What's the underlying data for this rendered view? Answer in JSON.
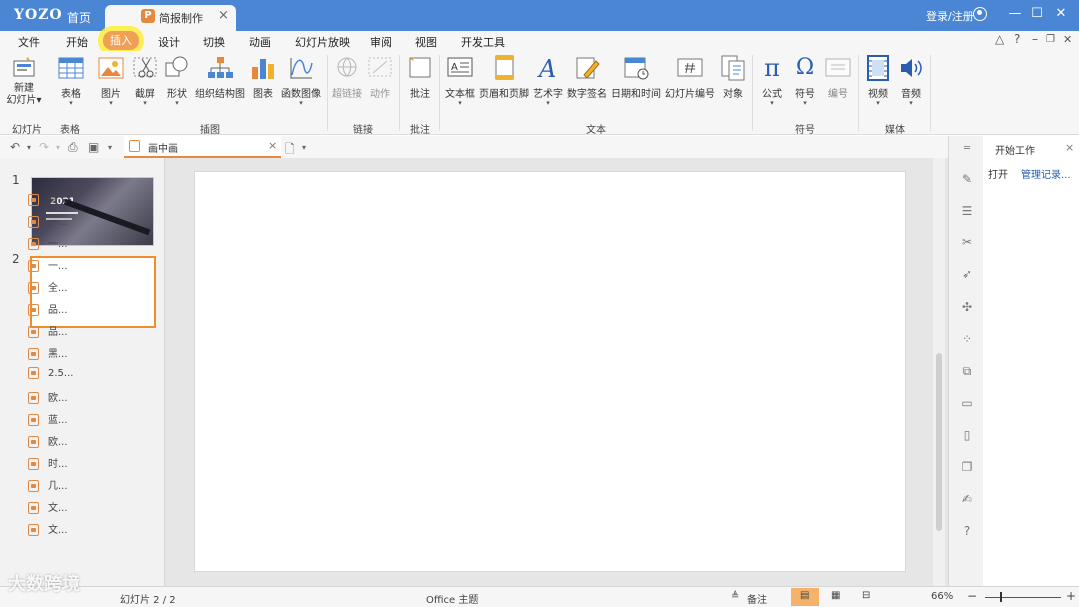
{
  "titlebar": {
    "logo": "YOZO",
    "home": "首页",
    "doc_tab": "简报制作",
    "tab_close": "×",
    "login": "登录/注册",
    "win_min": "—",
    "win_max": "☐",
    "win_close": "✕"
  },
  "menu": {
    "file": "文件",
    "home": "开始",
    "insert": "插入",
    "design": "设计",
    "transition": "切换",
    "animation": "动画",
    "slideshow": "幻灯片放映",
    "review": "审阅",
    "view": "视图",
    "devtools": "开发工具",
    "help": "?",
    "caret_up": "△",
    "win_min": "–",
    "win_restore": "❐",
    "win_close": "✕"
  },
  "ribbon": {
    "new_slide": "新建",
    "new_slide2": "幻灯片",
    "table": "表格",
    "picture": "图片",
    "screenshot": "截屏",
    "shape": "形状",
    "orgchart": "组织结构图",
    "chart": "图表",
    "function_graph": "函数图像",
    "hyperlink": "超链接",
    "action": "动作",
    "comment": "批注",
    "textbox": "文本框",
    "header_footer": "页眉和页脚",
    "wordart": "艺术字",
    "digital_sign": "数字签名",
    "datetime": "日期和时间",
    "slide_number": "幻灯片编号",
    "object": "对象",
    "formula": "公式",
    "symbol": "符号",
    "numbering": "编号",
    "video": "视频",
    "audio": "音频",
    "groups": {
      "slides": "幻灯片",
      "table": "表格",
      "illustration": "插图",
      "link": "链接",
      "comment": "批注",
      "text": "文本",
      "symbol": "符号",
      "media": "媒体"
    }
  },
  "file_tab": {
    "label": "画中画",
    "close": "×"
  },
  "slides": [
    {
      "num": "1",
      "year": "2021"
    },
    {
      "num": "2"
    }
  ],
  "taskpane": {
    "title": "开始工作",
    "close": "×",
    "open": "打开",
    "manage": "管理记录...",
    "recent": [
      "画...",
      "一...",
      "一...",
      "一...",
      "全...",
      "品...",
      "品...",
      "黑...",
      "2.5...",
      "欧...",
      "蓝...",
      "欧...",
      "时...",
      "几...",
      "文...",
      "文..."
    ]
  },
  "status": {
    "slide_count": "幻灯片 2 / 2",
    "theme": "Office 主题",
    "notes": "备注",
    "zoom": "66%",
    "zoom_minus": "−",
    "zoom_plus": "+"
  },
  "watermark": "大数跨境",
  "colors": {
    "titlebar": "#4a86d4",
    "accent": "#f08c2a",
    "highlight": "#ffec3c"
  }
}
